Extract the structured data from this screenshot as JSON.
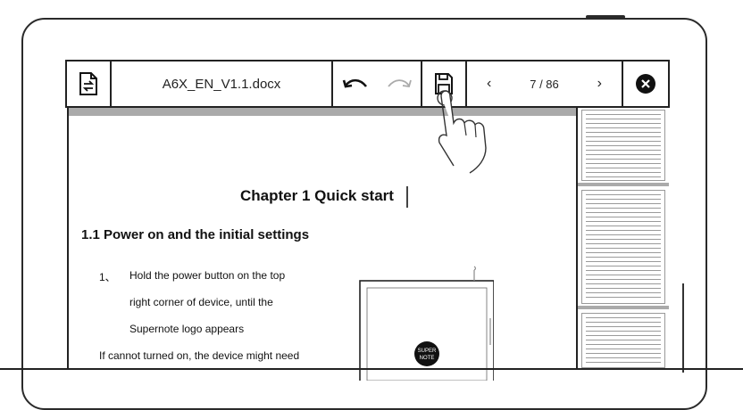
{
  "toolbar": {
    "doc_icon": "document-convert-icon",
    "file_name": "A6X_EN_V1.1.docx",
    "undo_icon": "undo-icon",
    "redo_icon": "redo-icon",
    "save_icon": "save-icon",
    "prev_icon": "chevron-left-icon",
    "page_indicator": "7 / 86",
    "next_icon": "chevron-right-icon",
    "close_icon": "close-icon"
  },
  "document": {
    "chapter_title": "Chapter 1 Quick start",
    "section_title": "1.1 Power on and the initial settings",
    "step_number": "1、",
    "step_line1": "Hold the power button on the top",
    "step_line2": "right corner of device, until the",
    "step_line3": "Supernote logo appears",
    "note_line": "If cannot turned on, the device might need",
    "logo_text": "SUPER NOTE"
  },
  "thumbnails": {
    "count_visible": 3
  }
}
